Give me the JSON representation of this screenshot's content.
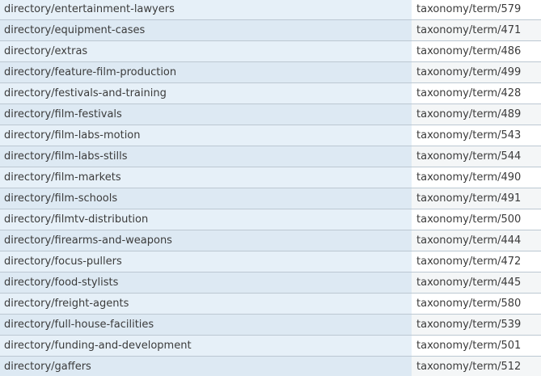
{
  "aliases": {
    "rows": [
      {
        "alias": "directory/entertainment-lawyers",
        "system": "taxonomy/term/579"
      },
      {
        "alias": "directory/equipment-cases",
        "system": "taxonomy/term/471"
      },
      {
        "alias": "directory/extras",
        "system": "taxonomy/term/486"
      },
      {
        "alias": "directory/feature-film-production",
        "system": "taxonomy/term/499"
      },
      {
        "alias": "directory/festivals-and-training",
        "system": "taxonomy/term/428"
      },
      {
        "alias": "directory/film-festivals",
        "system": "taxonomy/term/489"
      },
      {
        "alias": "directory/film-labs-motion",
        "system": "taxonomy/term/543"
      },
      {
        "alias": "directory/film-labs-stills",
        "system": "taxonomy/term/544"
      },
      {
        "alias": "directory/film-markets",
        "system": "taxonomy/term/490"
      },
      {
        "alias": "directory/film-schools",
        "system": "taxonomy/term/491"
      },
      {
        "alias": "directory/filmtv-distribution",
        "system": "taxonomy/term/500"
      },
      {
        "alias": "directory/firearms-and-weapons",
        "system": "taxonomy/term/444"
      },
      {
        "alias": "directory/focus-pullers",
        "system": "taxonomy/term/472"
      },
      {
        "alias": "directory/food-stylists",
        "system": "taxonomy/term/445"
      },
      {
        "alias": "directory/freight-agents",
        "system": "taxonomy/term/580"
      },
      {
        "alias": "directory/full-house-facilities",
        "system": "taxonomy/term/539"
      },
      {
        "alias": "directory/funding-and-development",
        "system": "taxonomy/term/501"
      },
      {
        "alias": "directory/gaffers",
        "system": "taxonomy/term/512"
      }
    ]
  }
}
